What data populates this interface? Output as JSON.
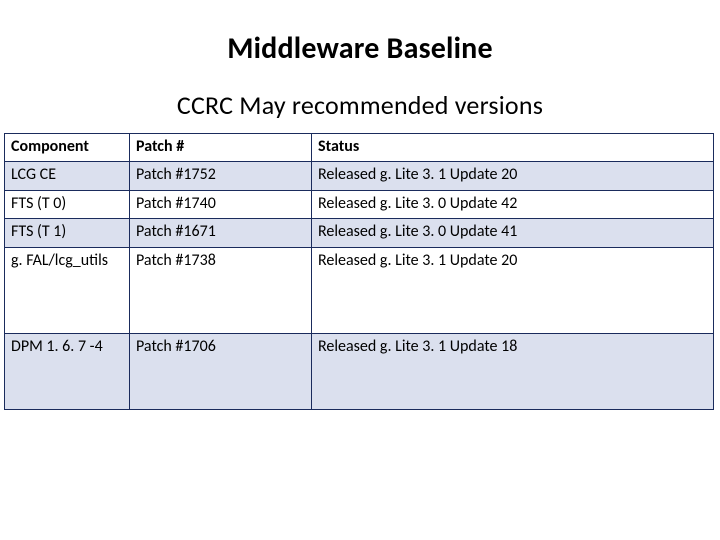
{
  "title": "Middleware Baseline",
  "subtitle": "CCRC May recommended versions",
  "table": {
    "headers": {
      "component": "Component",
      "patch": "Patch #",
      "status": "Status"
    },
    "rows": [
      {
        "component": "LCG CE",
        "patch": "Patch #1752",
        "status": "Released g. Lite 3. 1 Update 20"
      },
      {
        "component": "FTS (T 0)",
        "patch": "Patch #1740",
        "status": "Released g. Lite 3. 0 Update 42"
      },
      {
        "component": "FTS (T 1)",
        "patch": "Patch #1671",
        "status": "Released g. Lite 3. 0 Update 41"
      },
      {
        "component": "g. FAL/lcg_utils",
        "patch": "Patch #1738",
        "status": "Released g. Lite 3. 1 Update 20"
      },
      {
        "component": "DPM 1. 6. 7 -4",
        "patch": "Patch #1706",
        "status": "Released g. Lite 3. 1 Update 18"
      }
    ]
  }
}
